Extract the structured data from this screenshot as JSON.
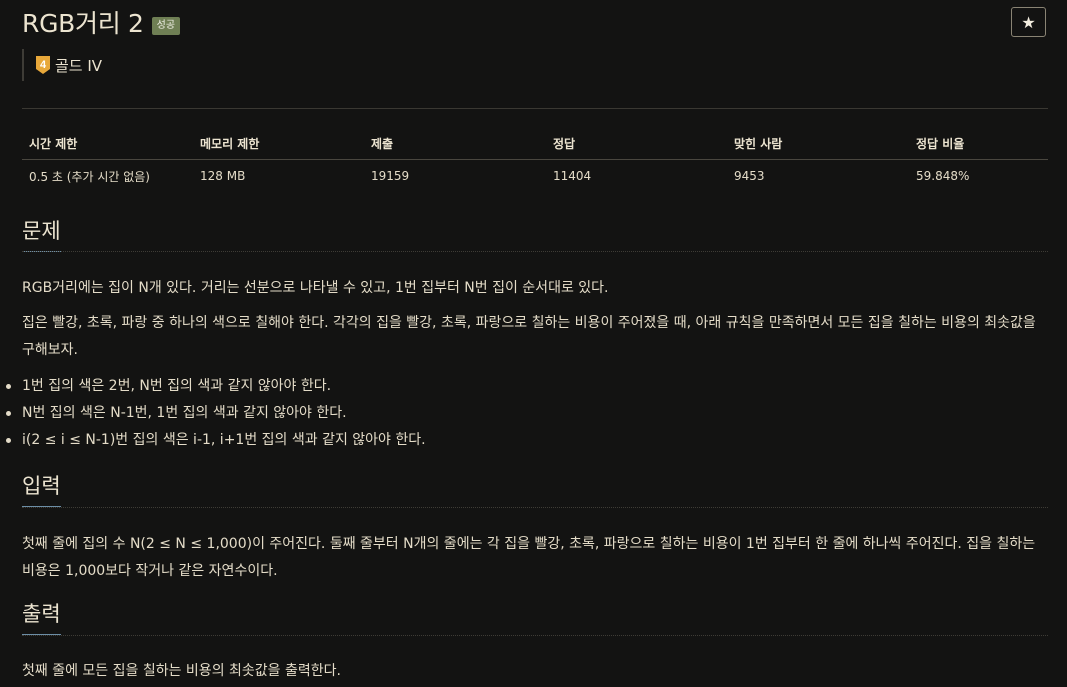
{
  "problem": {
    "title": "RGB거리 2",
    "status_badge": "성공",
    "tier_number": "4",
    "tier_label": "골드 IV",
    "star_label": "★"
  },
  "stats": {
    "headers": [
      "시간 제한",
      "메모리 제한",
      "제출",
      "정답",
      "맞힌 사람",
      "정답 비율"
    ],
    "values": [
      "0.5 초 (추가 시간 없음)",
      "128 MB",
      "19159",
      "11404",
      "9453",
      "59.848%"
    ]
  },
  "sections": {
    "description": {
      "title": "문제",
      "paragraphs": [
        "RGB거리에는 집이 N개 있다. 거리는 선분으로 나타낼 수 있고, 1번 집부터 N번 집이 순서대로 있다.",
        "집은 빨강, 초록, 파랑 중 하나의 색으로 칠해야 한다. 각각의 집을 빨강, 초록, 파랑으로 칠하는 비용이 주어졌을 때, 아래 규칙을 만족하면서 모든 집을 칠하는 비용의 최솟값을 구해보자."
      ],
      "rules": [
        "1번 집의 색은 2번, N번 집의 색과 같지 않아야 한다.",
        "N번 집의 색은 N-1번, 1번 집의 색과 같지 않아야 한다.",
        "i(2 ≤ i ≤ N-1)번 집의 색은 i-1, i+1번 집의 색과 같지 않아야 한다."
      ]
    },
    "input": {
      "title": "입력",
      "text": "첫째 줄에 집의 수 N(2 ≤ N ≤ 1,000)이 주어진다. 둘째 줄부터 N개의 줄에는 각 집을 빨강, 초록, 파랑으로 칠하는 비용이 1번 집부터 한 줄에 하나씩 주어진다. 집을 칠하는 비용은 1,000보다 작거나 같은 자연수이다."
    },
    "output": {
      "title": "출력",
      "text": "첫째 줄에 모든 집을 칠하는 비용의 최솟값을 출력한다."
    }
  },
  "colors": {
    "background": "#131312",
    "text": "#e4dcc8",
    "badge": "#6f7f54",
    "tier_gold": "#e8a83a",
    "section_underline": "#6c8ea6"
  }
}
